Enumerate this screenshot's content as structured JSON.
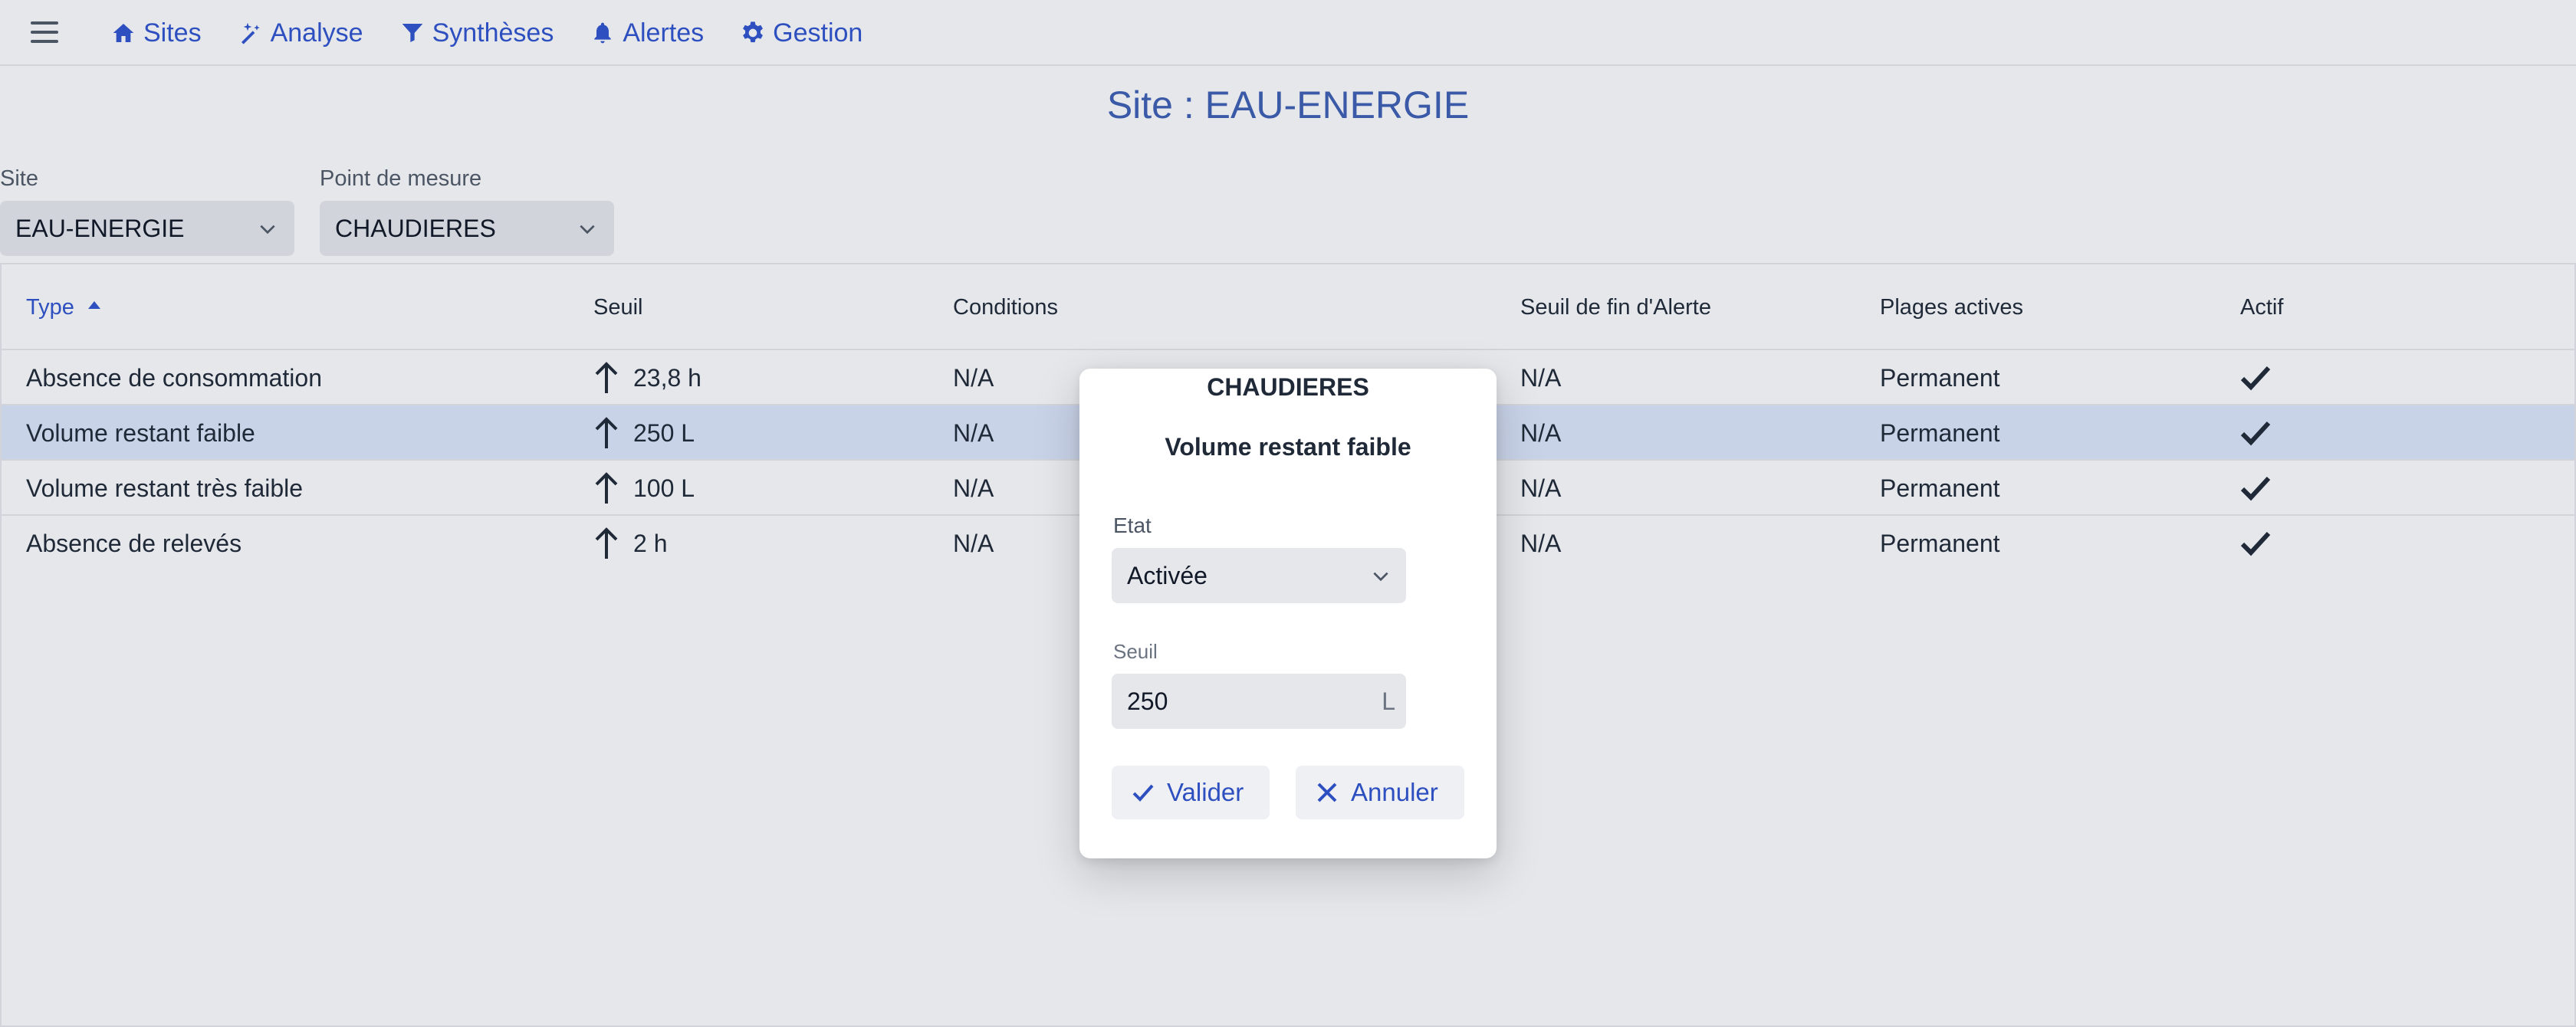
{
  "nav": {
    "items": [
      {
        "label": "Sites",
        "icon": "home-icon"
      },
      {
        "label": "Analyse",
        "icon": "magic-wand-icon"
      },
      {
        "label": "Synthèses",
        "icon": "filter-icon"
      },
      {
        "label": "Alertes",
        "icon": "bell-icon"
      },
      {
        "label": "Gestion",
        "icon": "gear-icon"
      }
    ],
    "accent_color": "#2d4fbf"
  },
  "page": {
    "title": "Site : EAU-ENERGIE"
  },
  "filters": {
    "site_label": "Site",
    "site_value": "EAU-ENERGIE",
    "point_label": "Point de mesure",
    "point_value": "CHAUDIERES"
  },
  "table": {
    "headers": {
      "type": "Type",
      "seuil": "Seuil",
      "conditions": "Conditions",
      "seuil_fin": "Seuil de fin d'Alerte",
      "plages": "Plages actives",
      "actif": "Actif"
    },
    "rows": [
      {
        "type": "Absence de consommation",
        "seuil": "23,8 h",
        "conditions": "N/A",
        "seuil_fin": "N/A",
        "plages": "Permanent",
        "actif": true
      },
      {
        "type": "Volume restant faible",
        "seuil": "250 L",
        "conditions": "N/A",
        "seuil_fin": "N/A",
        "plages": "Permanent",
        "actif": true
      },
      {
        "type": "Volume restant très faible",
        "seuil": "100 L",
        "conditions": "N/A",
        "seuil_fin": "N/A",
        "plages": "Permanent",
        "actif": true
      },
      {
        "type": "Absence de relevés",
        "seuil": "2 h",
        "conditions": "N/A",
        "seuil_fin": "N/A",
        "plages": "Permanent",
        "actif": true
      }
    ],
    "selected_row": 1
  },
  "modal": {
    "title": "CHAUDIERES",
    "subtitle": "Volume restant faible",
    "etat_label": "Etat",
    "etat_value": "Activée",
    "seuil_label": "Seuil",
    "seuil_value": "250",
    "seuil_unit": "L",
    "validate_label": "Valider",
    "cancel_label": "Annuler"
  }
}
